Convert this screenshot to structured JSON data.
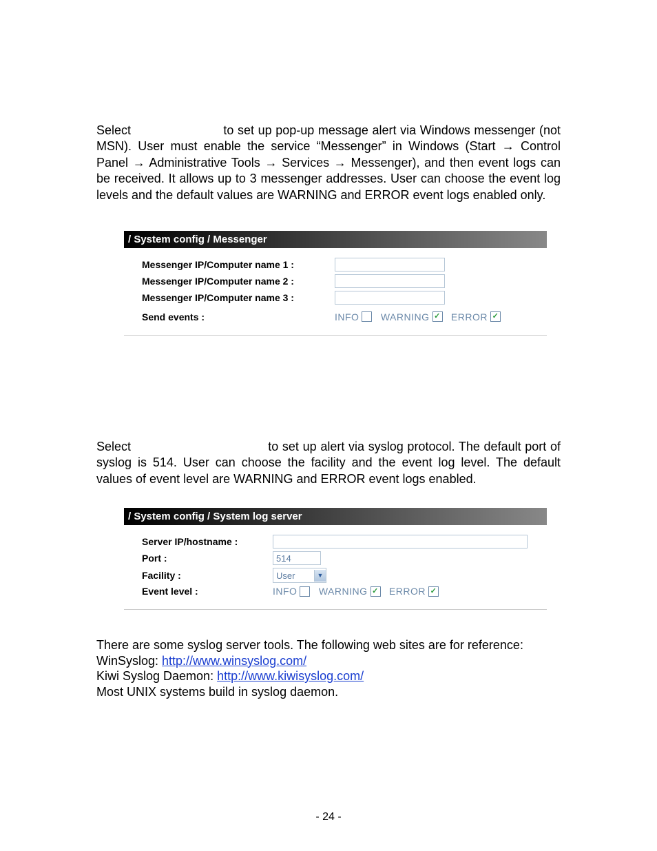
{
  "para1": {
    "select_word": "Select",
    "rest": "to set up pop-up message alert via Windows messenger (not MSN). User must enable the service “Messenger” in Windows (Start → Control Panel → Administrative Tools → Services → Messenger), and then event logs can be received. It allows up to 3 messenger addresses. User can choose the event log levels and the default values are WARNING and ERROR event logs enabled only."
  },
  "panel1": {
    "title": "/ System config / Messenger",
    "rows": [
      "Messenger IP/Computer name 1 :",
      "Messenger IP/Computer name 2 :",
      "Messenger IP/Computer name 3 :"
    ],
    "send_events_label": "Send events :",
    "events": {
      "info_label": "INFO",
      "info_checked": false,
      "warning_label": "WARNING",
      "warning_checked": true,
      "error_label": "ERROR",
      "error_checked": true
    }
  },
  "para2": {
    "select_word": "Select",
    "rest": "to set up alert via syslog protocol. The default port of syslog is 514. User can choose the facility and the event log level. The default values of event level are WARNING and ERROR event logs enabled."
  },
  "panel2": {
    "title": "/ System config / System log server",
    "server_label": "Server IP/hostname :",
    "port_label": "Port :",
    "port_value": "514",
    "facility_label": "Facility :",
    "facility_value": "User",
    "event_level_label": "Event level :",
    "events": {
      "info_label": "INFO",
      "info_checked": false,
      "warning_label": "WARNING",
      "warning_checked": true,
      "error_label": "ERROR",
      "error_checked": true
    }
  },
  "notes": {
    "line1": "There are some syslog server tools. The following web sites are for reference:",
    "line2a": "WinSyslog: ",
    "line2b": "http://www.winsyslog.com/",
    "line3a": "Kiwi Syslog Daemon: ",
    "line3b": "http://www.kiwisyslog.com/",
    "line4": "Most UNIX systems build in syslog daemon."
  },
  "page_number": "- 24 -"
}
